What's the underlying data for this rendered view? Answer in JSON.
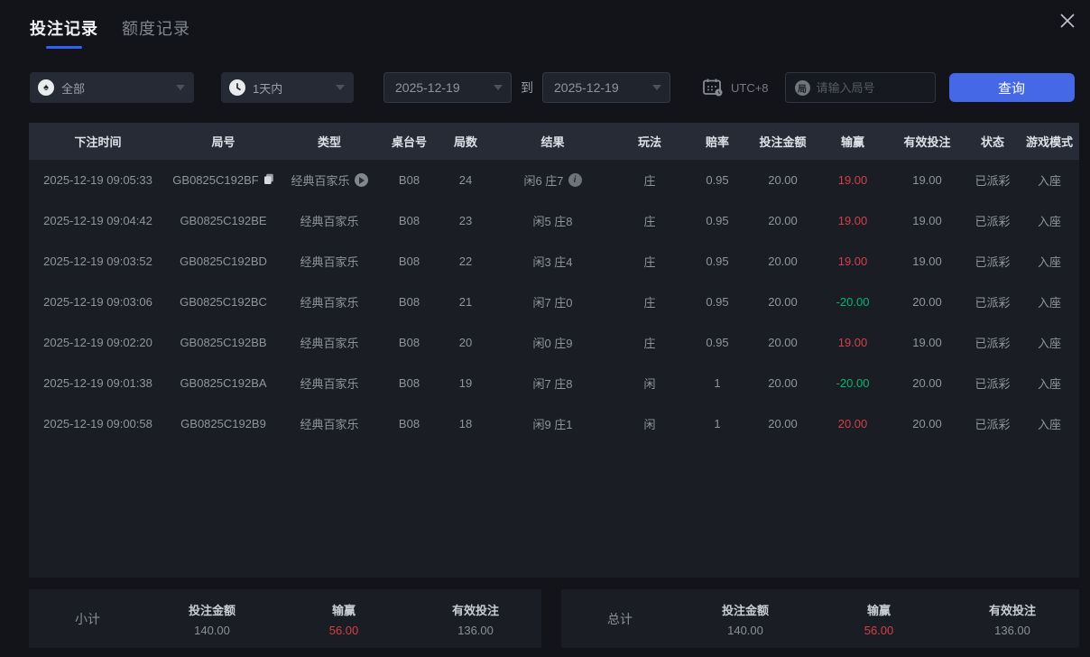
{
  "tabs": {
    "bet_records": "投注记录",
    "quota_records": "额度记录"
  },
  "filters": {
    "game_type_value": "全部",
    "game_type_icon_char": "♠",
    "time_range_value": "1天内",
    "date_from": "2025-12-19",
    "to_label": "到",
    "date_to": "2025-12-19",
    "timezone_label": "UTC+8",
    "round_input_icon_char": "局",
    "round_input_placeholder": "请输入局号",
    "query_button_label": "查询"
  },
  "table": {
    "headers": [
      "下注时间",
      "局号",
      "类型",
      "桌台号",
      "局数",
      "结果",
      "玩法",
      "赔率",
      "投注金额",
      "输赢",
      "有效投注",
      "状态",
      "游戏模式"
    ],
    "rows": [
      {
        "time": "2025-12-19 09:05:33",
        "round_id": "GB0825C192BF",
        "show_copy": true,
        "type": "经典百家乐",
        "show_play": true,
        "table_no": "B08",
        "round_no": "24",
        "result": "闲6 庄7",
        "show_info": true,
        "play": "庄",
        "odds": "0.95",
        "bet_amount": "20.00",
        "win_loss": "19.00",
        "win_color": "red",
        "valid_bet": "19.00",
        "status": "已派彩",
        "mode": "入座"
      },
      {
        "time": "2025-12-19 09:04:42",
        "round_id": "GB0825C192BE",
        "show_copy": false,
        "type": "经典百家乐",
        "show_play": false,
        "table_no": "B08",
        "round_no": "23",
        "result": "闲5 庄8",
        "show_info": false,
        "play": "庄",
        "odds": "0.95",
        "bet_amount": "20.00",
        "win_loss": "19.00",
        "win_color": "red",
        "valid_bet": "19.00",
        "status": "已派彩",
        "mode": "入座"
      },
      {
        "time": "2025-12-19 09:03:52",
        "round_id": "GB0825C192BD",
        "show_copy": false,
        "type": "经典百家乐",
        "show_play": false,
        "table_no": "B08",
        "round_no": "22",
        "result": "闲3 庄4",
        "show_info": false,
        "play": "庄",
        "odds": "0.95",
        "bet_amount": "20.00",
        "win_loss": "19.00",
        "win_color": "red",
        "valid_bet": "19.00",
        "status": "已派彩",
        "mode": "入座"
      },
      {
        "time": "2025-12-19 09:03:06",
        "round_id": "GB0825C192BC",
        "show_copy": false,
        "type": "经典百家乐",
        "show_play": false,
        "table_no": "B08",
        "round_no": "21",
        "result": "闲7 庄0",
        "show_info": false,
        "play": "庄",
        "odds": "0.95",
        "bet_amount": "20.00",
        "win_loss": "-20.00",
        "win_color": "green",
        "valid_bet": "20.00",
        "status": "已派彩",
        "mode": "入座"
      },
      {
        "time": "2025-12-19 09:02:20",
        "round_id": "GB0825C192BB",
        "show_copy": false,
        "type": "经典百家乐",
        "show_play": false,
        "table_no": "B08",
        "round_no": "20",
        "result": "闲0 庄9",
        "show_info": false,
        "play": "庄",
        "odds": "0.95",
        "bet_amount": "20.00",
        "win_loss": "19.00",
        "win_color": "red",
        "valid_bet": "19.00",
        "status": "已派彩",
        "mode": "入座"
      },
      {
        "time": "2025-12-19 09:01:38",
        "round_id": "GB0825C192BA",
        "show_copy": false,
        "type": "经典百家乐",
        "show_play": false,
        "table_no": "B08",
        "round_no": "19",
        "result": "闲7 庄8",
        "show_info": false,
        "play": "闲",
        "odds": "1",
        "bet_amount": "20.00",
        "win_loss": "-20.00",
        "win_color": "green",
        "valid_bet": "20.00",
        "status": "已派彩",
        "mode": "入座"
      },
      {
        "time": "2025-12-19 09:00:58",
        "round_id": "GB0825C192B9",
        "show_copy": false,
        "type": "经典百家乐",
        "show_play": false,
        "table_no": "B08",
        "round_no": "18",
        "result": "闲9 庄1",
        "show_info": false,
        "play": "闲",
        "odds": "1",
        "bet_amount": "20.00",
        "win_loss": "20.00",
        "win_color": "red",
        "valid_bet": "20.00",
        "status": "已派彩",
        "mode": "入座"
      }
    ]
  },
  "summary": {
    "subtotal": {
      "label": "小计",
      "bet_amount_label": "投注金额",
      "bet_amount": "140.00",
      "win_loss_label": "输赢",
      "win_loss": "56.00",
      "valid_bet_label": "有效投注",
      "valid_bet": "136.00"
    },
    "total": {
      "label": "总计",
      "bet_amount_label": "投注金额",
      "bet_amount": "140.00",
      "win_loss_label": "输赢",
      "win_loss": "56.00",
      "valid_bet_label": "有效投注",
      "valid_bet": "136.00"
    }
  },
  "colors": {
    "accent_blue": "#4468e6",
    "tab_underline": "#2f62f4",
    "win_red": "#d2404a",
    "loss_green": "#00b96f"
  }
}
